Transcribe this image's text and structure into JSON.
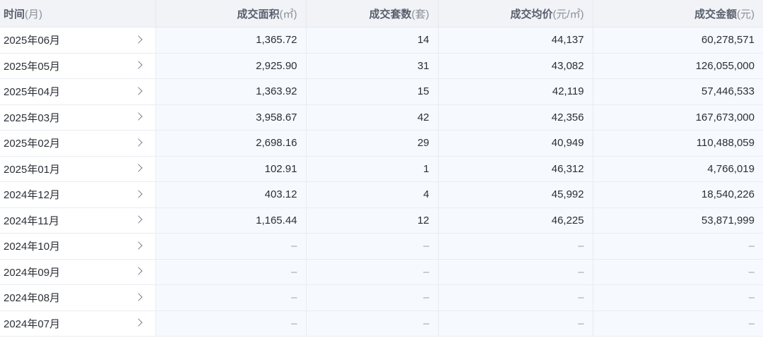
{
  "columns": {
    "month": {
      "label": "时间",
      "unit": "(月)"
    },
    "area": {
      "label": "成交面积",
      "unit": "(㎡)"
    },
    "count": {
      "label": "成交套数",
      "unit": "(套)"
    },
    "price": {
      "label": "成交均价",
      "unit": "(元/㎡)"
    },
    "amount": {
      "label": "成交金额",
      "unit": "(元)"
    }
  },
  "rows": [
    {
      "month": "2025年06月",
      "area": "1,365.72",
      "count": "14",
      "price": "44,137",
      "amount": "60,278,571"
    },
    {
      "month": "2025年05月",
      "area": "2,925.90",
      "count": "31",
      "price": "43,082",
      "amount": "126,055,000"
    },
    {
      "month": "2025年04月",
      "area": "1,363.92",
      "count": "15",
      "price": "42,119",
      "amount": "57,446,533"
    },
    {
      "month": "2025年03月",
      "area": "3,958.67",
      "count": "42",
      "price": "42,356",
      "amount": "167,673,000"
    },
    {
      "month": "2025年02月",
      "area": "2,698.16",
      "count": "29",
      "price": "40,949",
      "amount": "110,488,059"
    },
    {
      "month": "2025年01月",
      "area": "102.91",
      "count": "1",
      "price": "46,312",
      "amount": "4,766,019"
    },
    {
      "month": "2024年12月",
      "area": "403.12",
      "count": "4",
      "price": "45,992",
      "amount": "18,540,226"
    },
    {
      "month": "2024年11月",
      "area": "1,165.44",
      "count": "12",
      "price": "46,225",
      "amount": "53,871,999"
    },
    {
      "month": "2024年10月",
      "area": "–",
      "count": "–",
      "price": "–",
      "amount": "–"
    },
    {
      "month": "2024年09月",
      "area": "–",
      "count": "–",
      "price": "–",
      "amount": "–"
    },
    {
      "month": "2024年08月",
      "area": "–",
      "count": "–",
      "price": "–",
      "amount": "–"
    },
    {
      "month": "2024年07月",
      "area": "–",
      "count": "–",
      "price": "–",
      "amount": "–"
    }
  ],
  "icons": {
    "row_expand": "chevron-right-icon"
  },
  "colors": {
    "header_bg": "#f1f3f7",
    "data_bg": "#f6f9fe",
    "text": "#2b2f36"
  }
}
